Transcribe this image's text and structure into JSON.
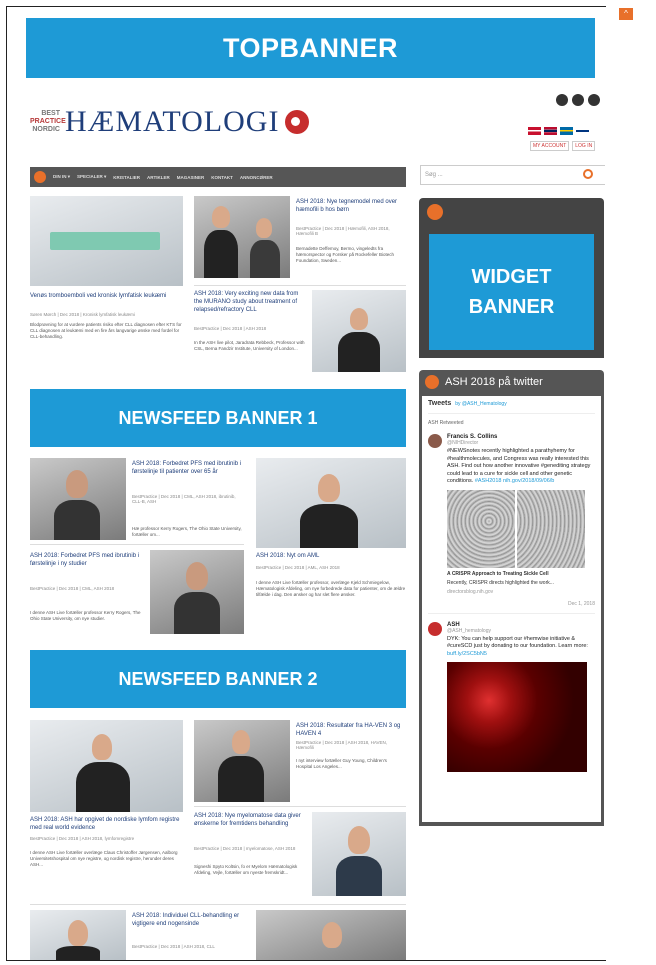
{
  "topbanner": "TOPBANNER",
  "logo": {
    "small": [
      "BEST",
      "PRACTICE",
      "NORDIC"
    ],
    "main": "HÆMATOLOGI"
  },
  "userlinks": [
    "MY ACCOUNT",
    "LOG IN"
  ],
  "nav": [
    "DIN IN ▾",
    "SPECIALER ▾",
    "KRISTALIER",
    "ARTIKLER",
    "MAGASINER",
    "KONTAKT",
    "ANNONCØRER"
  ],
  "search": {
    "placeholder": "Søg ..."
  },
  "widget": {
    "banner": "WIDGET BANNER"
  },
  "twitter": {
    "header": "ASH 2018 på twitter",
    "title": "Tweets",
    "title_by": "by @ASH_Hematology",
    "tweets": [
      {
        "retweeted_by": "ASH Retweeted",
        "name": "Francis S. Collins",
        "handle": "@NIHDirector",
        "text": "#NEWSnotes recently highlighted a parathyhemy for #healthmolecules, and Congress was really interested this ASH. Find out how another innovative #genediting strategy could lead to a cure for sickle cell and other genetic conditions.",
        "link": "#ASH2018 nih.gov/2018/09/06/b",
        "card_title": "A CRISPR Approach to Treating Sickle Cell",
        "card_text": "Recently, CRISPR directs highlighted the work...",
        "card_source": "directorsblog.nih.gov",
        "time": "Dec 1, 2018"
      },
      {
        "name": "ASH",
        "handle": "@ASH_hematology",
        "text": "DYK: You can help support our #hemwise initiative & #cureSCD just by donating to our foundation. Learn more:",
        "link": "buff.ly/2SC5bN5"
      }
    ]
  },
  "newsbanners": [
    "NEWSFEED BANNER 1",
    "NEWSFEED BANNER 2"
  ],
  "articles": [
    {
      "title": "Venøs tromboemboli ved kronisk lymfatisk leukæmi",
      "meta": "Søren Mørch | Dec 2018 | Kronisk lymfatisk leukæmi",
      "desc": "Blodprøvning for at vurdere patients risiko efter CLL diagnosen efter KTS for CLL diagnosen at leukæmi med en fire års langvarige ønske med fordel for CLL-behandling."
    },
    {
      "title": "ASH 2018: Nye tegnemodel med over hæmofili b hos børn",
      "meta": "BestPractice | Dec 2018 | Hæmofili, ASH 2018, Hæmofili B",
      "desc": "Bernadette Deffemoy, Bermo, vingeledts fra hæmorspector og Forsker på Rockefeller Biotech Foundation, Sweden..."
    },
    {
      "title": "ASH 2018: Very exciting new data from the MURANO study about treatment of relapsed/refractory CLL",
      "meta": "BestPractice | Dec 2018 | ASH 2018",
      "desc": "In the ASH live pilot, Jaradrata Rebbeck, Professor with CSL, Berna Fandzir Institute, University of London..."
    },
    {
      "title": "ASH 2018: Forbedret PFS med ibrutinib i førstelinje til patienter over 65 år",
      "meta": "BestPractice | Dec 2018 | CML, ASH 2018, ibrutinib, CLL-B, ASH",
      "desc": "Hæ professor Kerry Rogers, The Ohio State University, fortæller om..."
    },
    {
      "title": "ASH 2018: Nyt om AML",
      "meta": "BestPractice | Dec 2018 | AML, ASH 2018",
      "desc": "I denne ASH Live fortæller professor, overlæge Kjeld Schmiegelow, Hæmatologisk Afdeling, om nye forbedrede data for patienter, om de ældre tilfælde i dag. Den ønsker og har slet flere ønsker."
    },
    {
      "title": "ASH 2018: Forbedret PFS med ibrutinib i førstelinje i ny studier",
      "meta": "BestPractice | Dec 2018 | CML, ASH 2018",
      "desc": "I denne ASH Live fortæller professor Kerry Rogers, The Ohio State University, om nye studier."
    },
    {
      "title": "ASH 2018: ASH har opgivet de nordiske lymfom registre med real world evidence",
      "meta": "BestPractice | Dec 2018 | ASH 2018, lymfomregistre",
      "desc": "I denne ASH Live fortæller overlæge Claus Christoffer Jørgensen, Aalborg Universitetshospital om nye registre, og nordisk registre, herunder deres ASH..."
    },
    {
      "title": "ASH 2018: Resultater fra HA-VEN 3 og HAVEN 4",
      "meta": "BestPractice | Dec 2018 | ASH 2018, HAVEN, Hæmofili",
      "desc": "I nyt interview fortæller Guy Young, Children's Hospital Los Angeles..."
    },
    {
      "title": "ASH 2018: Nye myelomatose data giver ønskerne for fremtidens behandling",
      "meta": "BestPractice | Dec 2018 | myelomatose, ASH 2018",
      "desc": "Signeshi Spyto Koltsin, fo er Myelom Hæmatologisk Afdeling, Vejle, fortæller om nyeste fremskridt..."
    },
    {
      "title": "ASH 2018: Individuel CLL-behandling er vigtigere end nogensinde",
      "meta": "BestPractice | Dec 2018 | ASH 2018, CLL",
      "desc": ""
    }
  ]
}
